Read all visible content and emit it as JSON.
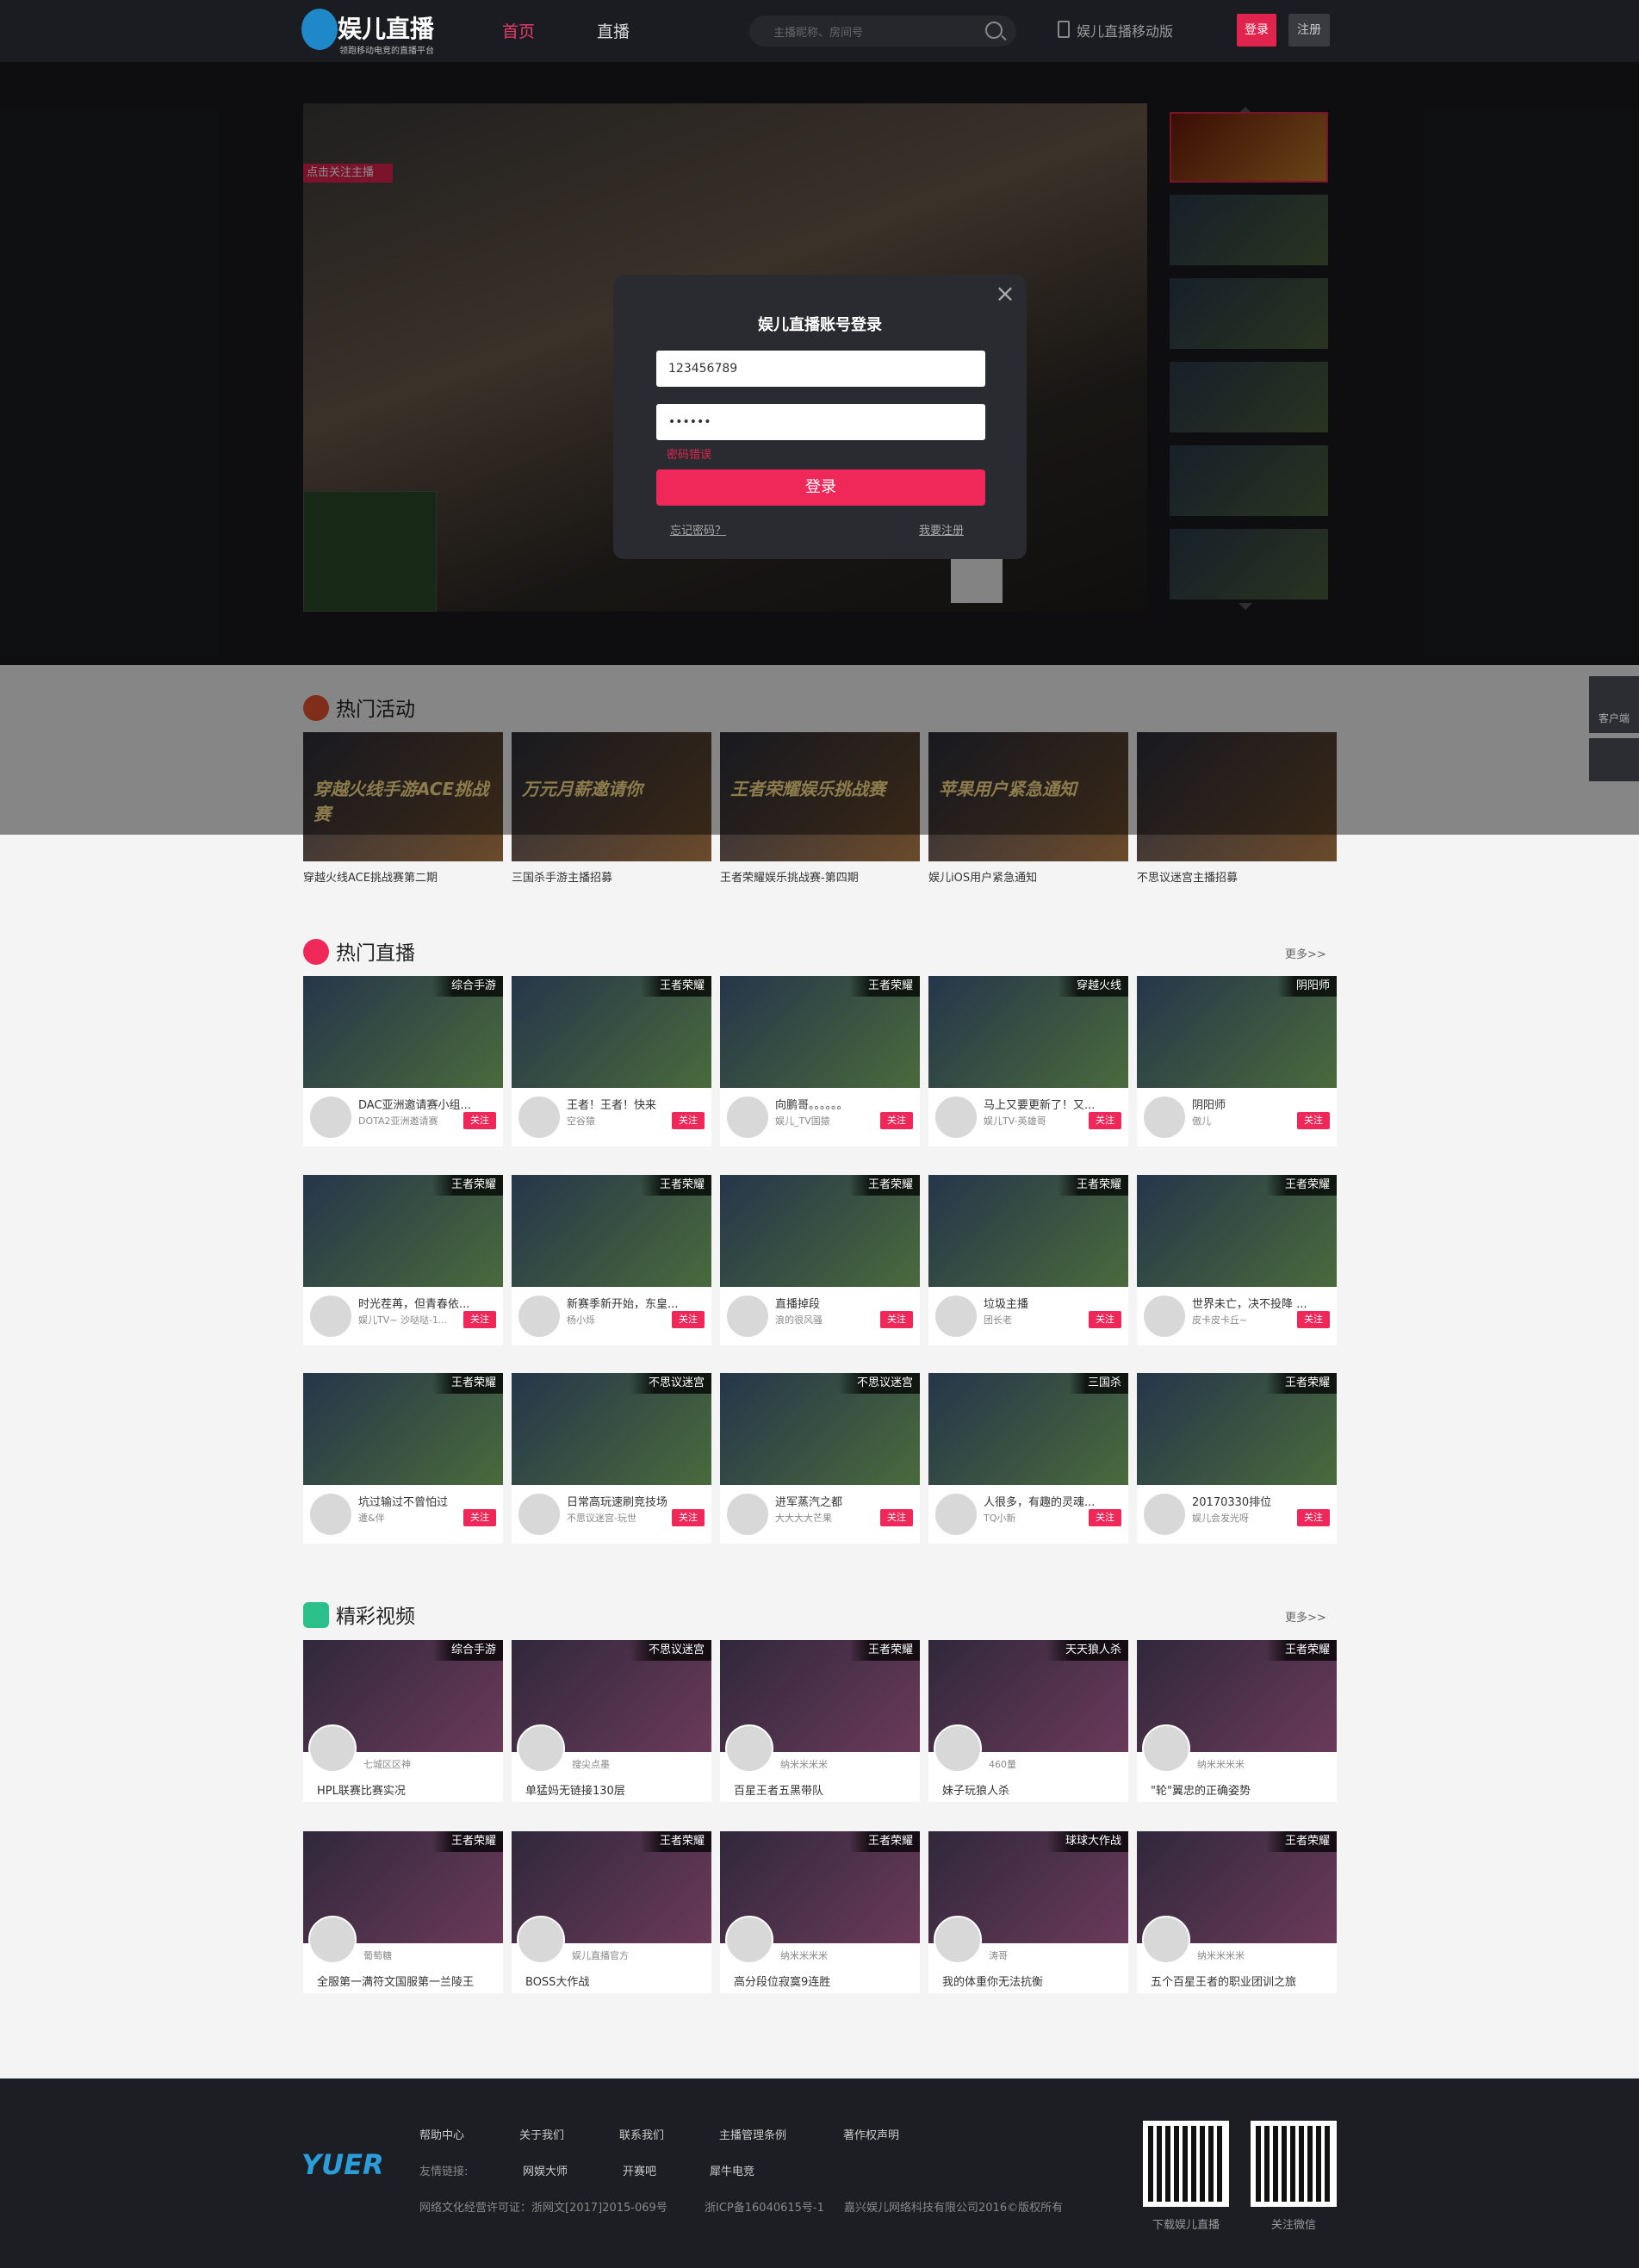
{
  "header": {
    "logo_text": "娱儿直播",
    "logo_sub": "领跑移动电竞的直播平台",
    "nav": [
      "首页",
      "直播"
    ],
    "search_placeholder": "主播昵称、房间号",
    "mobile_label": "娱儿直播移动版",
    "login_label": "登录",
    "register_label": "注册"
  },
  "player": {
    "follow_label": "点击关注主播"
  },
  "modal": {
    "title": "娱儿直播账号登录",
    "username": "123456789",
    "password": "••••••",
    "error": "密码错误",
    "submit": "登录",
    "forgot": "忘记密码？",
    "register": "我要注册"
  },
  "side": {
    "client_label": "客户端"
  },
  "hot_events": {
    "title": "热门活动",
    "items": [
      "穿越火线ACE挑战赛第二期",
      "三国杀手游主播招募",
      "王者荣耀娱乐挑战赛-第四期",
      "娱儿iOS用户紧急通知",
      "不思议迷宫主播招募"
    ],
    "banners": [
      "穿越火线手游ACE挑战赛",
      "万元月薪邀请你",
      "王者荣耀娱乐挑战赛",
      "苹果用户紧急通知",
      ""
    ]
  },
  "hot_live": {
    "title": "热门直播",
    "more": "更多>>",
    "follow": "关注",
    "cards": [
      {
        "tag": "综合手游",
        "title": "DAC亚洲邀请赛小组...",
        "user": "DOTA2亚洲邀请赛"
      },
      {
        "tag": "王者荣耀",
        "title": "王者！王者！快来",
        "user": "空谷猿"
      },
      {
        "tag": "王者荣耀",
        "title": "向鹏哥。。。。。。",
        "user": "娱儿_TV国猿"
      },
      {
        "tag": "穿越火线",
        "title": "马上又要更新了！又...",
        "user": "娱儿TV-英雄哥"
      },
      {
        "tag": "阴阳师",
        "title": "阴阳师",
        "user": "傲儿"
      },
      {
        "tag": "王者荣耀",
        "title": "时光茬苒，但青春依...",
        "user": "娱儿TV~ 沙哒哒-1..."
      },
      {
        "tag": "王者荣耀",
        "title": "新赛季新开始，东皇...",
        "user": "杨小烁"
      },
      {
        "tag": "王者荣耀",
        "title": "直播掉段",
        "user": "浪的很风骚"
      },
      {
        "tag": "王者荣耀",
        "title": "垃圾主播",
        "user": "团长老"
      },
      {
        "tag": "王者荣耀",
        "title": "世界未亡，决不投降 ...",
        "user": "皮卡皮卡丘~"
      },
      {
        "tag": "王者荣耀",
        "title": "坑过输过不曾怕过",
        "user": "遭&伴"
      },
      {
        "tag": "不思议迷宫",
        "title": "日常高玩速刷竞技场",
        "user": "不思议迷宫-玩世"
      },
      {
        "tag": "不思议迷宫",
        "title": "进军蒸汽之都",
        "user": "大大大大芒果"
      },
      {
        "tag": "三国杀",
        "title": "人很多，有趣的灵魂...",
        "user": "TQ小新"
      },
      {
        "tag": "王者荣耀",
        "title": "20170330排位",
        "user": "娱儿会发光呀"
      }
    ]
  },
  "videos": {
    "title": "精彩视频",
    "more": "更多>>",
    "cards": [
      {
        "tag": "综合手游",
        "user": "七城区区神",
        "title": "HPL联赛比赛实况"
      },
      {
        "tag": "不思议迷宫",
        "user": "搜尖点墨",
        "title": "单猛妈无链接130层"
      },
      {
        "tag": "王者荣耀",
        "user": "纳米米米米",
        "title": "百星王者五黑带队"
      },
      {
        "tag": "天天狼人杀",
        "user": "460量",
        "title": "妹子玩狼人杀"
      },
      {
        "tag": "王者荣耀",
        "user": "纳米米米米",
        "title": "\"轮\"翼忠的正确姿势"
      },
      {
        "tag": "王者荣耀",
        "user": "葡萄糖",
        "title": "全服第一满符文国服第一兰陵王"
      },
      {
        "tag": "王者荣耀",
        "user": "娱儿直播官方",
        "title": "BOSS大作战"
      },
      {
        "tag": "王者荣耀",
        "user": "纳米米米米",
        "title": "高分段位寂寞9连胜"
      },
      {
        "tag": "球球大作战",
        "user": "涛哥",
        "title": "我的体重你无法抗衡"
      },
      {
        "tag": "王者荣耀",
        "user": "纳米米米米",
        "title": "五个百星王者的职业团训之旅"
      }
    ]
  },
  "footer": {
    "logo": "YUER",
    "links": [
      "帮助中心",
      "关于我们",
      "联系我们",
      "主播管理条例",
      "著作权声明"
    ],
    "friends_label": "友情链接:",
    "friends": [
      "网娱大师",
      "开赛吧",
      "犀牛电竞"
    ],
    "license": "网络文化经营许可证：浙网文[2017]2015-069号",
    "icp": "浙ICP备16040615号-1",
    "copyright": "嘉兴娱儿网络科技有限公司2016©版权所有",
    "qr_labels": [
      "下载娱儿直播",
      "关注微信"
    ]
  }
}
